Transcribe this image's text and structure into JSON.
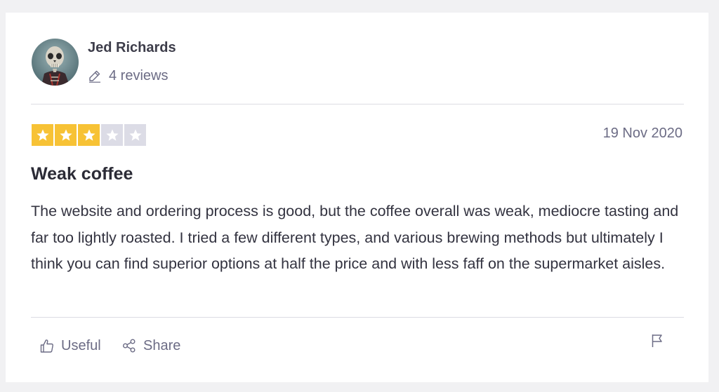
{
  "reviewer": {
    "name": "Jed Richards",
    "reviews_count": "4 reviews",
    "avatar_icon": "skeleton-avatar"
  },
  "review": {
    "rating": 3,
    "rating_max": 5,
    "date": "19 Nov 2020",
    "title": "Weak coffee",
    "body": "The website and ordering process is good, but the coffee overall was weak, mediocre tasting and far too lightly roasted. I tried a few different types, and various brewing methods but ultimately I think you can find superior options at half the price and with less faff on the supermarket aisles."
  },
  "actions": {
    "useful_label": "Useful",
    "share_label": "Share",
    "useful_icon": "thumbs-up-icon",
    "share_icon": "share-icon",
    "flag_icon": "flag-icon"
  },
  "colors": {
    "star_filled": "#f7c235",
    "star_empty": "#dcdce6",
    "muted_text": "#6c6c85",
    "body_text": "#333340"
  }
}
